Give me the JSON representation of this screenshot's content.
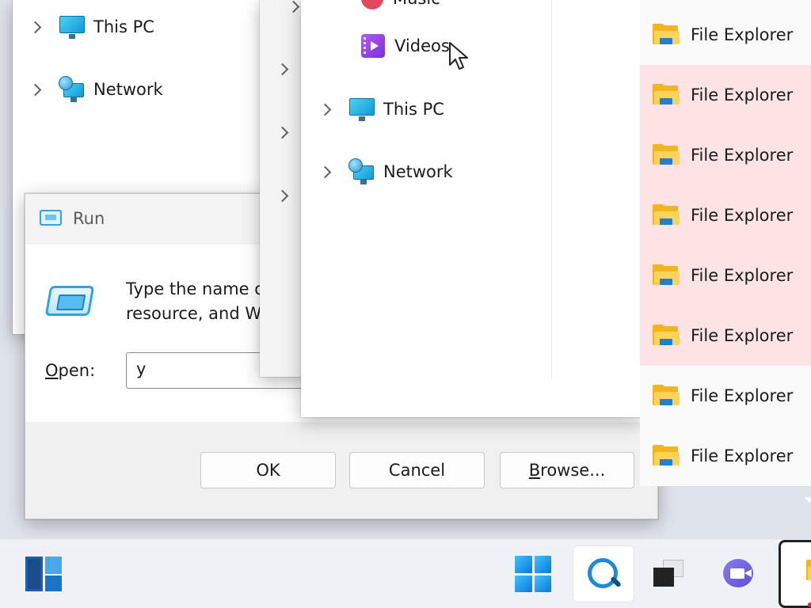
{
  "explorer_back": {
    "nav_items": [
      "This PC",
      "Network"
    ]
  },
  "explorer_front": {
    "nav_items": [
      "Music",
      "Videos",
      "This PC",
      "Network"
    ]
  },
  "run_dialog": {
    "title": "Run",
    "description_line1": "Type the name o",
    "description_line2": "resource, and W",
    "open_label_prefix": "O",
    "open_label_rest": "pen:",
    "input_value": "y",
    "ok_label": "OK",
    "cancel_label": "Cancel",
    "browse_label_prefix": "B",
    "browse_label_rest": "rowse..."
  },
  "jumplist": {
    "items": [
      {
        "label": "File Explorer",
        "highlighted": false
      },
      {
        "label": "File Explorer",
        "highlighted": true
      },
      {
        "label": "File Explorer",
        "highlighted": true
      },
      {
        "label": "File Explorer",
        "highlighted": true
      },
      {
        "label": "File Explorer",
        "highlighted": true
      },
      {
        "label": "File Explorer",
        "highlighted": true
      },
      {
        "label": "File Explorer",
        "highlighted": false
      },
      {
        "label": "File Explorer",
        "highlighted": false
      }
    ]
  },
  "taskbar": {
    "icons": [
      "widgets-icon",
      "start-icon",
      "search-icon",
      "task-view-icon",
      "teams-chat-icon",
      "file-explorer-icon"
    ]
  },
  "colors": {
    "highlight": "#fde3e4",
    "accent": "#0b78d8",
    "folder": "#f2b51d"
  }
}
